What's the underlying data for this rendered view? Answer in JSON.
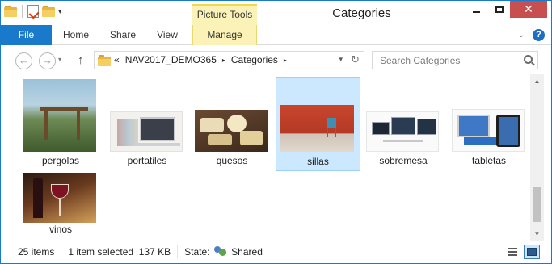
{
  "window": {
    "title": "Categories",
    "context_tab_group": "Picture Tools",
    "controls": {
      "minimize": "—",
      "maximize": "☐",
      "close": "✕"
    }
  },
  "quick_access": {
    "customize_arrow": "▾"
  },
  "ribbon": {
    "tabs": [
      {
        "label": "File"
      },
      {
        "label": "Home"
      },
      {
        "label": "Share"
      },
      {
        "label": "View"
      },
      {
        "label": "Manage"
      }
    ],
    "help_label": "?",
    "expand_glyph": "⌄"
  },
  "navigation": {
    "back_glyph": "←",
    "forward_glyph": "→",
    "recent_glyph": "▾",
    "up_glyph": "↑",
    "address": {
      "overflow_glyph": "«",
      "crumbs": [
        "NAV2017_DEMO365",
        "Categories"
      ],
      "separator": "▸",
      "dropdown_glyph": "▾",
      "refresh_glyph": "↻"
    },
    "search": {
      "placeholder": "Search Categories"
    }
  },
  "items": [
    {
      "label": "pergolas",
      "selected": false
    },
    {
      "label": "portatiles",
      "selected": false
    },
    {
      "label": "quesos",
      "selected": false
    },
    {
      "label": "sillas",
      "selected": true
    },
    {
      "label": "sobremesa",
      "selected": false
    },
    {
      "label": "tabletas",
      "selected": false
    },
    {
      "label": "vinos",
      "selected": false
    }
  ],
  "scrollbar": {
    "up_glyph": "▲",
    "down_glyph": "▼"
  },
  "status": {
    "item_count": "25 items",
    "selection": "1 item selected",
    "size": "137 KB",
    "state_label": "State:",
    "state_value": "Shared"
  },
  "colors": {
    "accent": "#1979ca",
    "context_tab": "#fbf2b7",
    "selection": "#cce8ff",
    "close_button": "#c74f4f"
  }
}
